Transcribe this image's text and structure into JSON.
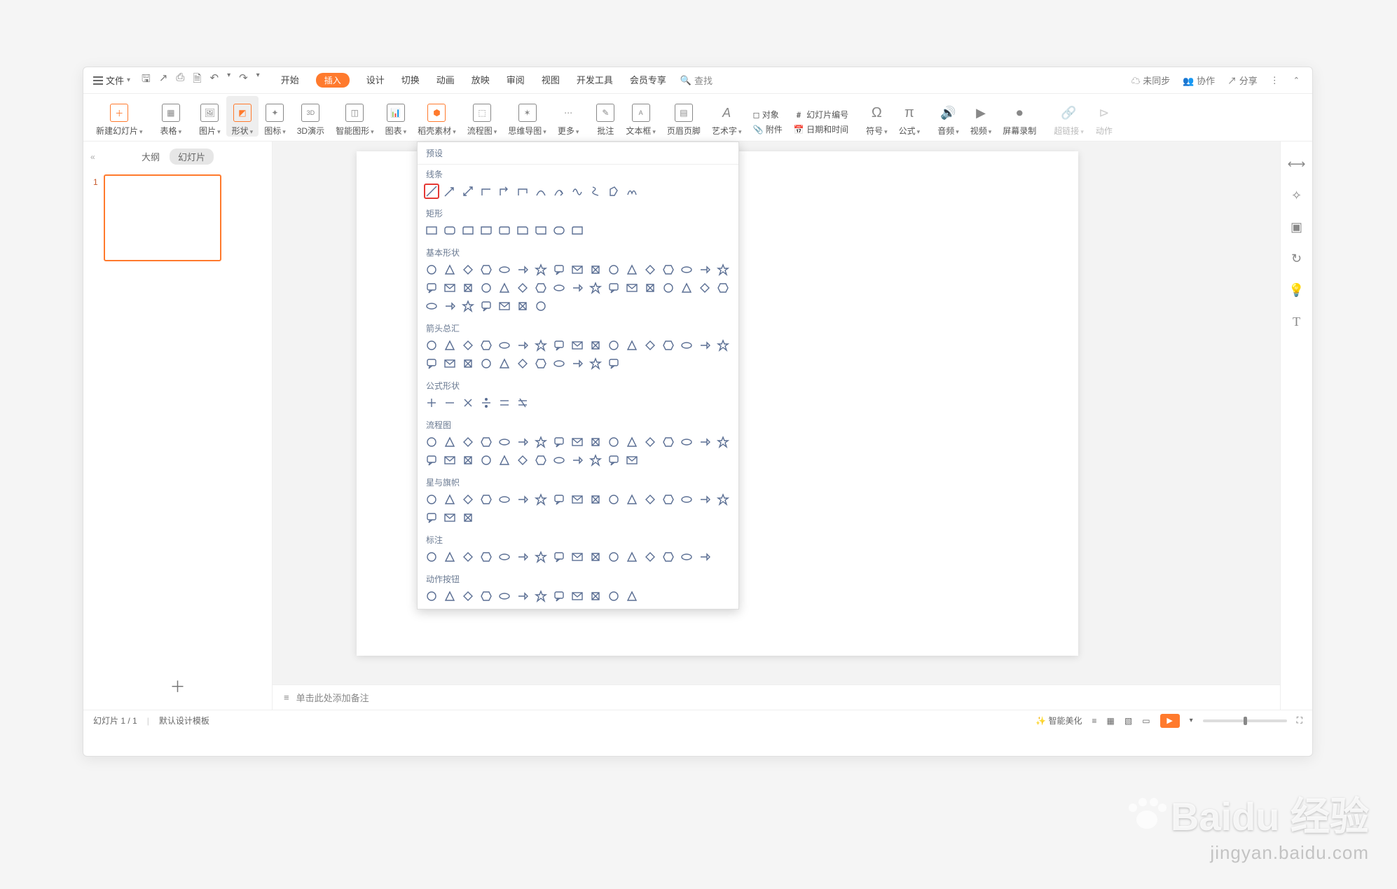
{
  "menubar": {
    "file": "文件",
    "tabs": [
      "开始",
      "插入",
      "设计",
      "切换",
      "动画",
      "放映",
      "审阅",
      "视图",
      "开发工具",
      "会员专享"
    ],
    "active_tab_index": 1,
    "search_placeholder": "查找",
    "right": {
      "sync": "未同步",
      "collab": "协作",
      "share": "分享"
    }
  },
  "ribbon": {
    "items": [
      {
        "label": "新建幻灯片",
        "dd": true
      },
      {
        "label": "表格",
        "dd": true
      },
      {
        "label": "图片",
        "dd": true
      },
      {
        "label": "形状",
        "dd": true,
        "active": true
      },
      {
        "label": "图标",
        "dd": true
      },
      {
        "label": "3D演示",
        "dd": false
      },
      {
        "label": "智能图形",
        "dd": true
      },
      {
        "label": "图表",
        "dd": true
      },
      {
        "label": "稻壳素材",
        "dd": true
      },
      {
        "label": "流程图",
        "dd": true
      },
      {
        "label": "思维导图",
        "dd": true
      },
      {
        "label": "更多",
        "dd": true
      },
      {
        "label": "批注",
        "dd": false
      },
      {
        "label": "文本框",
        "dd": true
      },
      {
        "label": "页眉页脚",
        "dd": false
      },
      {
        "label": "艺术字",
        "dd": true
      },
      {
        "label": "附件",
        "dd": false,
        "icon": "📎"
      },
      {
        "label": "日期和时间",
        "dd": false,
        "icon": "📅"
      },
      {
        "label": "对象",
        "dd": false,
        "icon": "◻"
      },
      {
        "label": "幻灯片编号",
        "dd": false,
        "icon": "#"
      },
      {
        "label": "符号",
        "dd": true
      },
      {
        "label": "公式",
        "dd": true
      },
      {
        "label": "音频",
        "dd": true
      },
      {
        "label": "视频",
        "dd": true
      },
      {
        "label": "屏幕录制",
        "dd": false
      },
      {
        "label": "超链接",
        "dd": true,
        "disabled": true
      },
      {
        "label": "动作",
        "dd": false,
        "disabled": true
      }
    ]
  },
  "leftpane": {
    "collapse": "«",
    "tab_outline": "大纲",
    "tab_slides": "幻灯片",
    "thumb_num": "1"
  },
  "notes_placeholder": "单击此处添加备注",
  "status": {
    "slide_counter": "幻灯片 1 / 1",
    "template": "默认设计模板",
    "beautify": "智能美化",
    "zoom_pct": "",
    "views": [
      "≡",
      "▦",
      "▧",
      "▥"
    ]
  },
  "shapes_panel": {
    "header": "预设",
    "categories": [
      "线条",
      "矩形",
      "基本形状",
      "箭头总汇",
      "公式形状",
      "流程图",
      "星与旗帜",
      "标注",
      "动作按钮"
    ],
    "counts": {
      "线条": 12,
      "矩形": 9,
      "基本形状": 41,
      "箭头总汇": 28,
      "公式形状": 6,
      "流程图": 29,
      "星与旗帜": 20,
      "标注": 16,
      "动作按钮": 12
    },
    "highlight": "line-1"
  },
  "watermark": {
    "brand": "Baidu 经验",
    "url": "jingyan.baidu.com"
  }
}
